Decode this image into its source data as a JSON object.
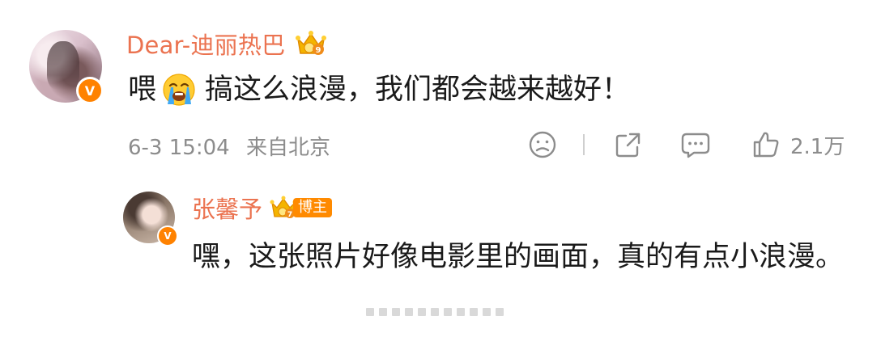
{
  "main_comment": {
    "username": "Dear-迪丽热巴",
    "text_prefix": "喂",
    "emoji": "loudly-crying-face-emoji",
    "text_body": "搞这么浪漫，我们都会越来越好！",
    "timestamp": "6-3 15:04",
    "location": "来自北京",
    "like_count": "2.1万"
  },
  "reply": {
    "username": "张馨予",
    "badge_label": "博主",
    "text": "嘿，这张照片好像电影里的画面，真的有点小浪漫。"
  },
  "colors": {
    "accent_name": "#eb7350",
    "verified": "#ff8200",
    "meta_gray": "#8c8c8c",
    "host_badge": "#ff8a00"
  },
  "icons": {
    "verified_badge": "V",
    "action_icons": [
      "dislike-face-icon",
      "share-icon",
      "comment-icon",
      "like-thumb-icon"
    ]
  }
}
